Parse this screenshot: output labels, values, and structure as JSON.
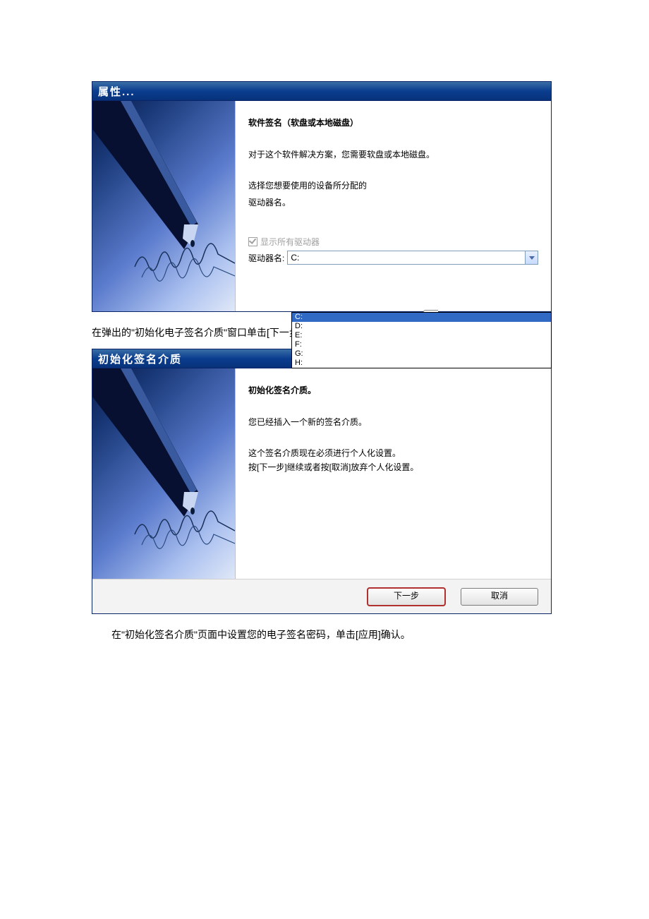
{
  "dialog1": {
    "title": "属性...",
    "content_title": "软件签名（软盘或本地磁盘）",
    "line1": "对于这个软件解决方案，您需要软盘或本地磁盘。",
    "line2a": "选择您想要使用的设备所分配的",
    "line2b": "驱动器名。",
    "checkbox_label": "显示所有驱动器",
    "drive_label": "驱动器名:",
    "drive_value": "C:",
    "options": [
      "C:",
      "D:",
      "E:",
      "F:",
      "G:",
      "H:"
    ]
  },
  "para1": "在弹出的\"初始化电子签名介质\"窗口单击[下一步] 进行确认。",
  "dialog2": {
    "title": "初始化签名介质",
    "content_title": "初始化签名介质。",
    "line1": "您已经插入一个新的签名介质。",
    "line2a": "这个签名介质现在必须进行个人化设置。",
    "line2b": "按[下一步]继续或者按[取消]放弃个人化设置。",
    "btn_next": "下一步",
    "btn_cancel": "取消"
  },
  "para2": "在\"初始化签名介质\"页面中设置您的电子签名密码，单击[应用]确认。"
}
